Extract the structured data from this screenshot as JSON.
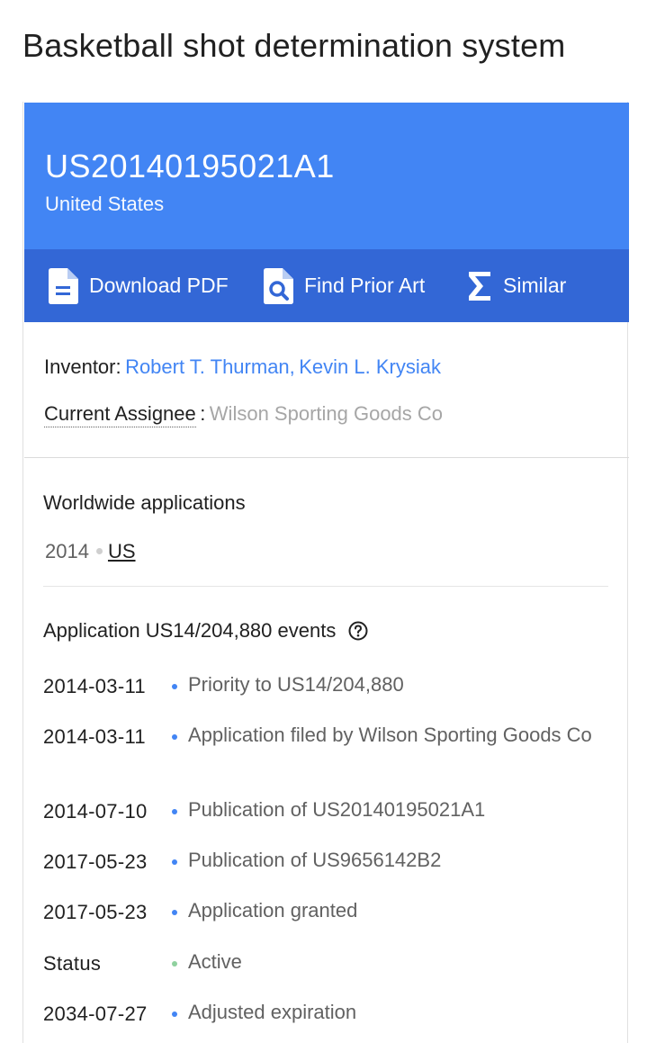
{
  "page_title": "Basketball shot determination system",
  "header": {
    "publication_number": "US20140195021A1",
    "country": "United States",
    "color": "#4285f4"
  },
  "actions": [
    {
      "label": "Download PDF",
      "icon": "pdf-file-icon"
    },
    {
      "label": "Find Prior Art",
      "icon": "prior-art-search-icon"
    },
    {
      "label": "Similar",
      "icon": "sigma-icon"
    }
  ],
  "people": {
    "inventor_label": "Inventor:",
    "inventors": [
      "Robert T. Thurman",
      "Kevin L. Krysiak"
    ],
    "inventor_separator": ",",
    "assignee_label": "Current Assignee",
    "assignee_colon": ":",
    "assignee": "Wilson Sporting Goods Co"
  },
  "worldwide": {
    "title": "Worldwide applications",
    "year": "2014",
    "country": "US"
  },
  "events": {
    "title": "Application US14/204,880 events",
    "items": [
      {
        "date": "2014-03-11",
        "text": "Priority to US14/204,880",
        "dot": "blue"
      },
      {
        "date": "2014-03-11",
        "text": "Application filed by Wilson Sporting Goods Co",
        "dot": "blue"
      },
      {
        "date": "2014-07-10",
        "text": "Publication of US20140195021A1",
        "dot": "blue"
      },
      {
        "date": "2017-05-23",
        "text": "Publication of US9656142B2",
        "dot": "blue"
      },
      {
        "date": "2017-05-23",
        "text": "Application granted",
        "dot": "blue"
      },
      {
        "date": "Status",
        "text": "Active",
        "dot": "green"
      },
      {
        "date": "2034-07-27",
        "text": "Adjusted expiration",
        "dot": "blue"
      }
    ]
  }
}
